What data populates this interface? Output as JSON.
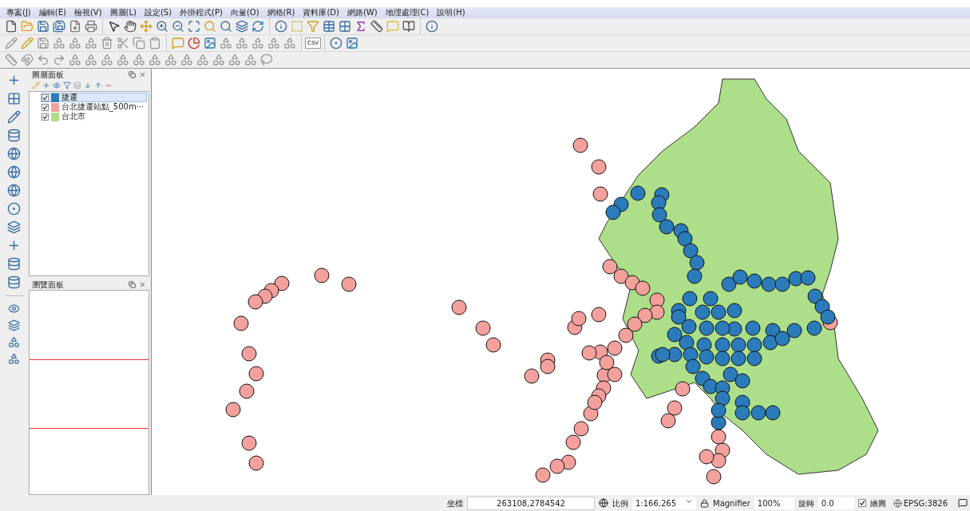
{
  "menu": [
    "專案(J)",
    "編輯(E)",
    "檢視(V)",
    "圖層(L)",
    "設定(S)",
    "外掛程式(P)",
    "向量(O)",
    "網格(R)",
    "資料庫(D)",
    "網路(W)",
    "地理處理(C)",
    "說明(H)"
  ],
  "toolbar": {
    "csv_label": "CSV"
  },
  "layers_panel": {
    "title": "圖層面板",
    "layers": [
      {
        "name": "捷運",
        "color": "#2b7bba",
        "checked": true,
        "selected": true
      },
      {
        "name": "台北捷運站點_500m···",
        "color": "#f4a09c",
        "checked": true,
        "selected": false
      },
      {
        "name": "台北市",
        "color": "#addf8a",
        "checked": true,
        "selected": false
      }
    ]
  },
  "browser_panel": {
    "title": "瀏覽面板"
  },
  "status_bar": {
    "coordinate_label": "坐標",
    "coordinate": "263108,2784542",
    "scale_label": "比例",
    "scale": "1:166,265",
    "magnifier_label": "Magnifier",
    "magnifier": "100%",
    "rotation_label": "旋轉",
    "rotation": "0.0",
    "render": {
      "label": "繪圖",
      "checked": true
    },
    "crs": "EPSG:3826"
  }
}
